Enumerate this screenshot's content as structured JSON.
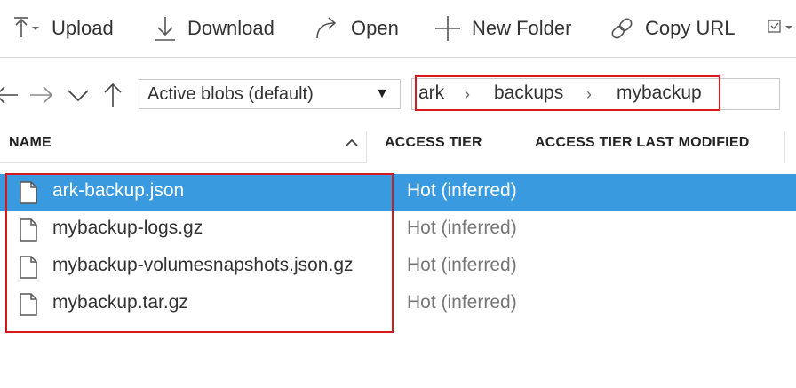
{
  "toolbar": {
    "upload_label": "Upload",
    "download_label": "Download",
    "open_label": "Open",
    "new_folder_label": "New Folder",
    "copy_url_label": "Copy URL"
  },
  "nav": {
    "view_select_value": "Active blobs (default)"
  },
  "breadcrumb": [
    "ark",
    "backups",
    "mybackup"
  ],
  "table": {
    "columns": [
      "NAME",
      "ACCESS TIER",
      "ACCESS TIER LAST MODIFIED"
    ],
    "rows": [
      {
        "name": "ark-backup.json",
        "tier": "Hot (inferred)",
        "selected": true
      },
      {
        "name": "mybackup-logs.gz",
        "tier": "Hot (inferred)",
        "selected": false
      },
      {
        "name": "mybackup-volumesnapshots.json.gz",
        "tier": "Hot (inferred)",
        "selected": false
      },
      {
        "name": "mybackup.tar.gz",
        "tier": "Hot (inferred)",
        "selected": false
      }
    ]
  },
  "colors": {
    "selection": "#3a9ae0",
    "highlight_box": "#d6191c"
  },
  "icons": [
    "upload-icon",
    "download-icon",
    "open-icon",
    "new-folder-icon",
    "copy-url-icon",
    "more-actions-icon",
    "back-icon",
    "forward-icon",
    "chevron-down-icon",
    "up-icon",
    "sort-ascending-icon",
    "file-icon"
  ]
}
